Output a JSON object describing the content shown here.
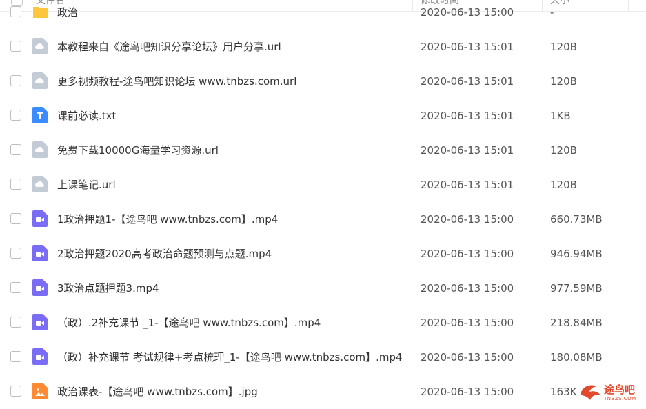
{
  "header": {
    "name_label": "文件名",
    "time_label": "修改时间",
    "size_label": "大小"
  },
  "rows": [
    {
      "icon": "folder-icon",
      "name": "政治",
      "time": "2020-06-13 15:00",
      "size": "-"
    },
    {
      "icon": "link-file-icon",
      "name": "本教程来自《途鸟吧知识分享论坛》用户分享.url",
      "time": "2020-06-13 15:01",
      "size": "120B"
    },
    {
      "icon": "link-file-icon",
      "name": "更多视频教程-途鸟吧知识论坛 www.tnbzs.com.url",
      "time": "2020-06-13 15:01",
      "size": "120B"
    },
    {
      "icon": "text-file-icon",
      "name": "课前必读.txt",
      "time": "2020-06-13 15:01",
      "size": "1KB"
    },
    {
      "icon": "link-file-icon",
      "name": "免费下载10000G海量学习资源.url",
      "time": "2020-06-13 15:01",
      "size": "120B"
    },
    {
      "icon": "link-file-icon",
      "name": "上课笔记.url",
      "time": "2020-06-13 15:01",
      "size": "120B"
    },
    {
      "icon": "video-file-icon",
      "name": "1政治押题1-【途鸟吧 www.tnbzs.com】.mp4",
      "time": "2020-06-13 15:00",
      "size": "660.73MB"
    },
    {
      "icon": "video-file-icon",
      "name": "2政治押题2020高考政治命题预测与点题.mp4",
      "time": "2020-06-13 15:00",
      "size": "946.94MB"
    },
    {
      "icon": "video-file-icon",
      "name": "3政治点题押题3.mp4",
      "time": "2020-06-13 15:00",
      "size": "977.59MB"
    },
    {
      "icon": "video-file-icon",
      "name": "（政）.2补充课节 _1-【途鸟吧 www.tnbzs.com】.mp4",
      "time": "2020-06-13 15:00",
      "size": "218.84MB"
    },
    {
      "icon": "video-file-icon",
      "name": "（政）补充课节 考试规律+考点梳理_1-【途鸟吧 www.tnbzs.com】.mp4",
      "time": "2020-06-13 15:00",
      "size": "180.08MB"
    },
    {
      "icon": "image-file-icon",
      "name": "政治课表-【途鸟吧 www.tnbzs.com】.jpg",
      "time": "2020-06-13 15:00",
      "size": "163K"
    }
  ],
  "watermark": {
    "text": "途鸟吧",
    "sub": "TNBZS.COM"
  },
  "colors": {
    "folder": "#ffc53d",
    "link": "#c3cbd6",
    "text": "#3b8cff",
    "video": "#7b6cf6",
    "image": "#ff8a34"
  }
}
